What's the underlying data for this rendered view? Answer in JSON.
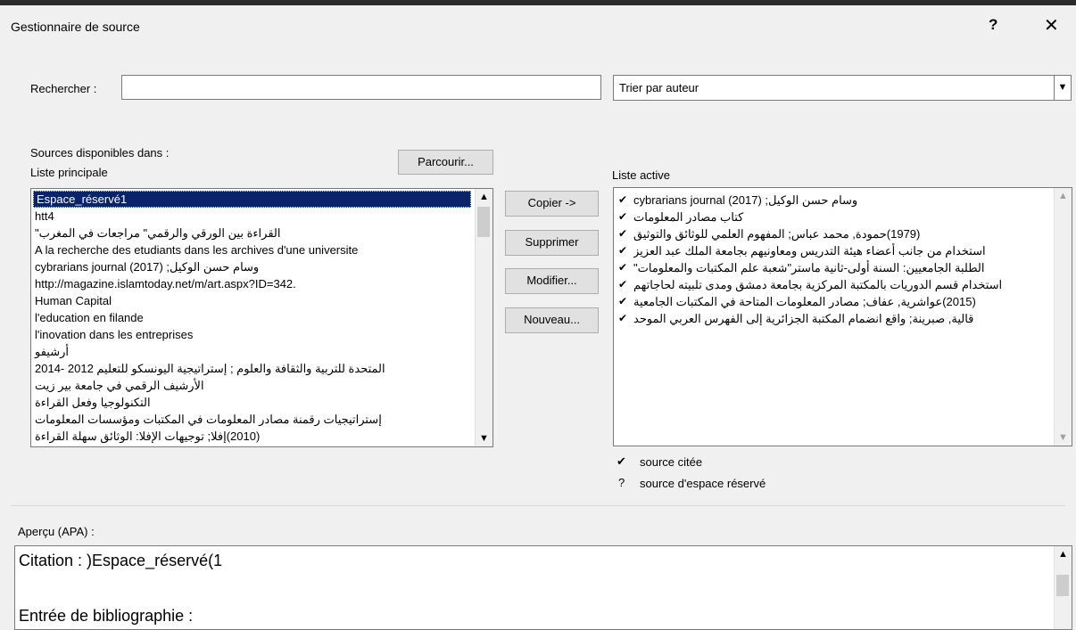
{
  "window": {
    "title": "Gestionnaire de source",
    "help_label": "?",
    "close_label": "✕"
  },
  "search": {
    "label": "Rechercher :",
    "value": "",
    "placeholder": ""
  },
  "sort": {
    "value": "Trier par auteur"
  },
  "sources": {
    "label": "Sources disponibles dans :",
    "list_name": "Liste principale",
    "browse_label": "Parcourir..."
  },
  "main_list": [
    "Espace_réservé1",
    "htt4",
    "القراءة بين الورقي والرقمي\" مراجعات في المغرب\"",
    "A la recherche des etudiants dans les archives d'une universite",
    "وسام حسن الوكيل; cybrarians journal (2017)",
    "http://magazine.islamtoday.net/m/art.aspx?ID=342.",
    "Human Capital",
    "l'education en filande",
    "l'inovation dans les entreprises",
    "أرشيفو",
    "المتحدة للتربية والثقافة والعلوم ; إستراتيجية اليونسكو للتعليم 2012 -2014",
    "الأرشيف الرقمي في جامعة بير زيت",
    "التكنولوجيا وفعل القراءة",
    "إستراتيجيات رقمنة مصادر المعلومات في المكتبات ومؤسسات المعلومات",
    "(2010)إفلا; توجيهات الإفلا: الوثائق سهلة القراءة"
  ],
  "actions": {
    "copy": "Copier ->",
    "delete": "Supprimer",
    "edit": "Modifier...",
    "new": "Nouveau..."
  },
  "active": {
    "label": "Liste active",
    "items": [
      "وسام حسن الوكيل; cybrarians journal (2017)",
      "كتاب مصادر المعلومات",
      "(1979)حمودة, محمد عباس; المفهوم العلمي للوثائق والتوثيق",
      "استخدام من جانب أعضاء هيئة التدريس ومعاونيهم بجامعة الملك عبد العزيز",
      "الطلبة الجامعيين: السنة أولى-ثانية ماستر\"شعبة علم المكتبات والمعلومات\"",
      "استخدام قسم الدوريات بالمكتبة المركزية بجامعة دمشق ومدى تلبيته لحاجاتهم",
      "(2015)عواشرية, عفاف; مصادر المعلومات المتاحة في المكتبات الجامعية",
      "قالية, صبرينة; واقع انضمام المكتبة الجزائرية إلى الفهرس العربي الموحد"
    ]
  },
  "legend": {
    "cited_mark": "✔",
    "cited_label": "source citée",
    "placeholder_mark": "?",
    "placeholder_label": "source d'espace réservé"
  },
  "preview": {
    "label": "Aperçu (APA) :",
    "citation": "Citation : )Espace_réservé(1",
    "bibliography": "Entrée de bibliographie :"
  }
}
